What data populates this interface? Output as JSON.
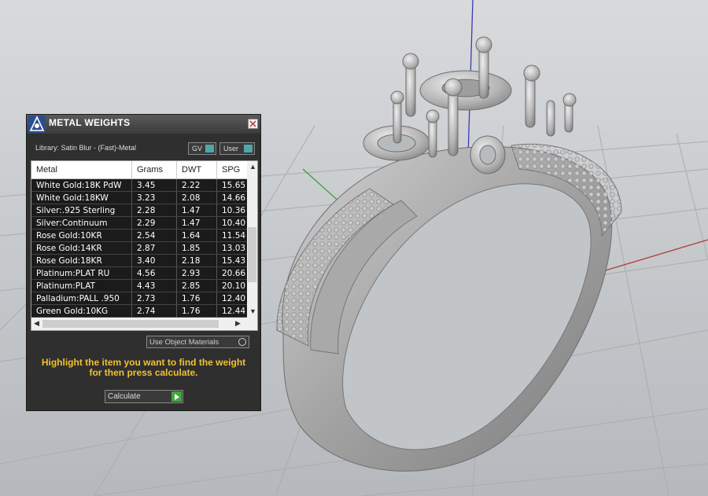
{
  "panel": {
    "title": "METAL WEIGHTS",
    "close_label": "X",
    "library": "Library: Satin Blur - (Fast)-Metal",
    "toggle_gv": "GV",
    "toggle_user": "User",
    "columns": [
      "Metal",
      "Grams",
      "DWT",
      "SPG"
    ],
    "rows": [
      [
        "White Gold:18K PdW",
        "3.45",
        "2.22",
        "15.65"
      ],
      [
        "White Gold:18KW",
        "3.23",
        "2.08",
        "14.66"
      ],
      [
        "Silver:.925 Sterling",
        "2.28",
        "1.47",
        "10.36"
      ],
      [
        "Silver:Continuum",
        "2.29",
        "1.47",
        "10.40"
      ],
      [
        "Rose Gold:10KR",
        "2.54",
        "1.64",
        "11.54"
      ],
      [
        "Rose Gold:14KR",
        "2.87",
        "1.85",
        "13.03"
      ],
      [
        "Rose Gold:18KR",
        "3.40",
        "2.18",
        "15.43"
      ],
      [
        "Platinum:PLAT RU",
        "4.56",
        "2.93",
        "20.66"
      ],
      [
        "Platinum:PLAT",
        "4.43",
        "2.85",
        "20.10"
      ],
      [
        "Palladium:PALL .950",
        "2.73",
        "1.76",
        "12.40"
      ],
      [
        "Green Gold:10KG",
        "2.74",
        "1.76",
        "12.44"
      ]
    ],
    "use_object_materials": "Use Object Materials",
    "hint_line1": "Highlight the item you want to find the weight",
    "hint_line2": "for then press calculate.",
    "calculate_label": "Calculate"
  },
  "viewport": {
    "background_color": "#c4c7ca",
    "grid_color": "#a9adb1",
    "axis_x_color": "#b33a3a",
    "axis_y_color": "#3aa03a",
    "axis_z_color": "#3a3ab3",
    "model": "ring-icon"
  }
}
